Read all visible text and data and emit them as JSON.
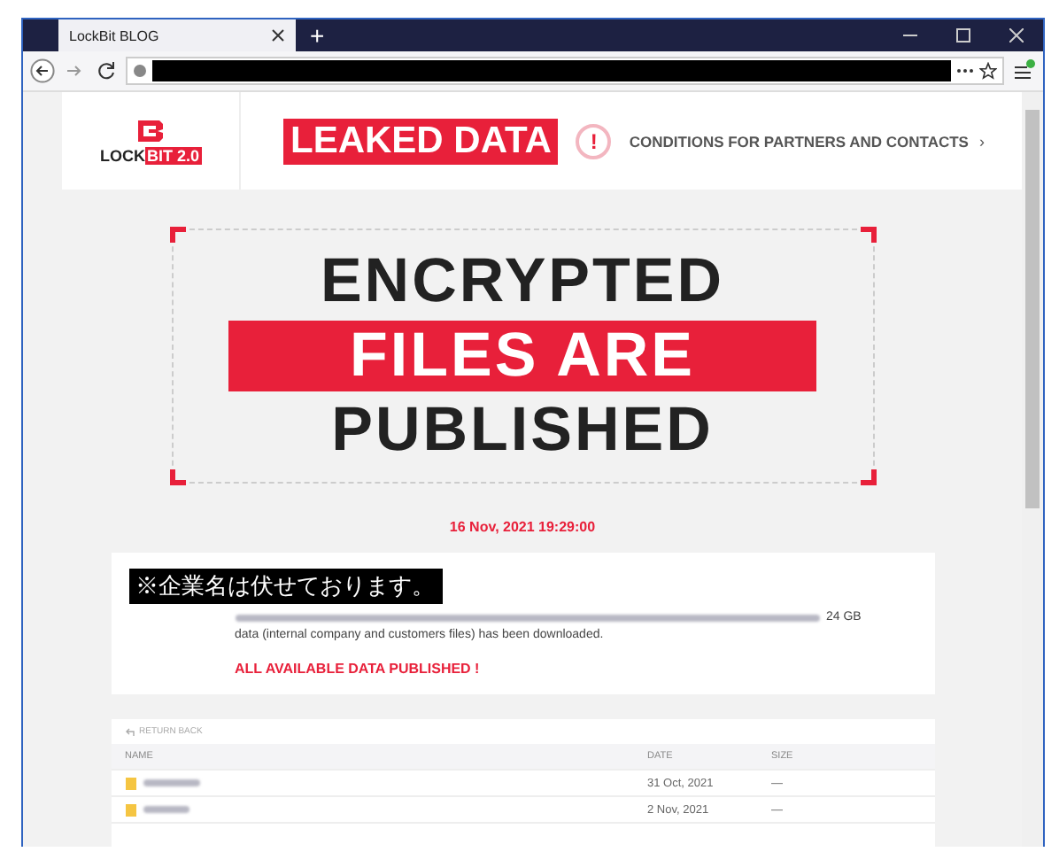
{
  "browser": {
    "tab_title": "LockBit BLOG",
    "new_tab": "+"
  },
  "header": {
    "logo_text": "LOCK",
    "logo_badge": "BIT 2.0",
    "banner": "LEAKED DATA",
    "alert": "!",
    "link": "CONDITIONS FOR PARTNERS AND CONTACTS",
    "link_arrow": "›"
  },
  "hero": {
    "lines": [
      {
        "text": "ENCRYPTED",
        "highlighted": false
      },
      {
        "text": "FILES ARE",
        "highlighted": true
      },
      {
        "text": "PUBLISHED",
        "highlighted": false
      }
    ]
  },
  "post": {
    "date": "16 Nov, 2021 19:29:00",
    "notice": "※企業名は伏せております。",
    "size": "24 GB",
    "description": "data (internal company and customers files) has been downloaded.",
    "status": "ALL AVAILABLE DATA PUBLISHED !"
  },
  "files": {
    "return_link": "RETURN BACK",
    "columns": [
      "NAME",
      "DATE",
      "SIZE"
    ],
    "rows": [
      {
        "date": "31 Oct, 2021",
        "size": "—"
      },
      {
        "date": "2 Nov, 2021",
        "size": "—"
      }
    ]
  }
}
